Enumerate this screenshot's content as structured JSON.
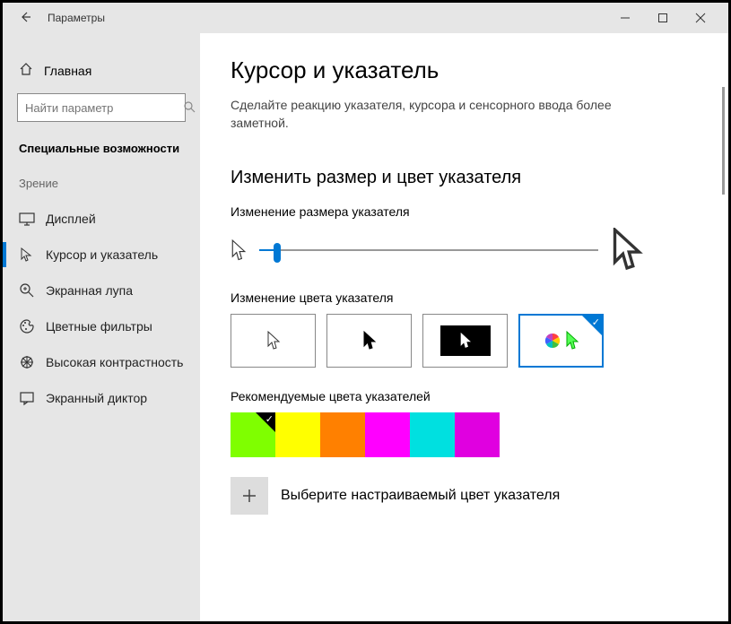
{
  "titlebar": {
    "title": "Параметры"
  },
  "sidebar": {
    "home": "Главная",
    "search_placeholder": "Найти параметр",
    "category": "Специальные возможности",
    "group": "Зрение",
    "items": [
      {
        "label": "Дисплей"
      },
      {
        "label": "Курсор и указатель"
      },
      {
        "label": "Экранная лупа"
      },
      {
        "label": "Цветные фильтры"
      },
      {
        "label": "Высокая контрастность"
      },
      {
        "label": "Экранный диктор"
      }
    ]
  },
  "main": {
    "title": "Курсор и указатель",
    "description": "Сделайте реакцию указателя, курсора и сенсорного ввода более заметной.",
    "section_title": "Изменить размер и цвет указателя",
    "size_label": "Изменение размера указателя",
    "color_label": "Изменение цвета указателя",
    "recommended_label": "Рекомендуемые цвета указателей",
    "custom_label": "Выберите настраиваемый цвет указателя",
    "colors": [
      "#7fff00",
      "#ffff00",
      "#ff8000",
      "#ff00ff",
      "#00e0e0",
      "#e000e0"
    ]
  }
}
